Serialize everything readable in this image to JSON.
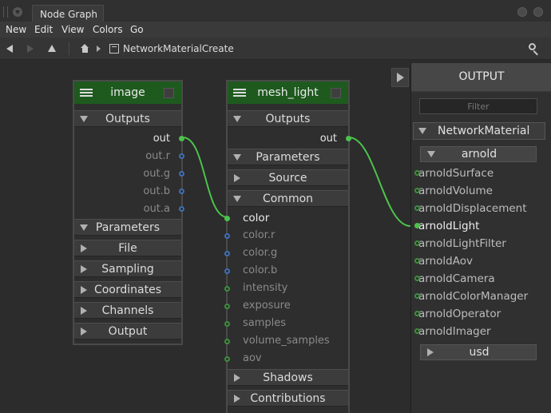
{
  "tab": {
    "title": "Node Graph"
  },
  "menu": [
    "New",
    "Edit",
    "View",
    "Colors",
    "Go"
  ],
  "toolbar": {
    "path": "NetworkMaterialCreate"
  },
  "nodes": {
    "image": {
      "title": "image",
      "outputs_label": "Outputs",
      "ports": [
        "out",
        "out.r",
        "out.g",
        "out.b",
        "out.a"
      ],
      "parameters_label": "Parameters",
      "groups": [
        "File",
        "Sampling",
        "Coordinates",
        "Channels",
        "Output"
      ]
    },
    "mesh_light": {
      "title": "mesh_light",
      "outputs_label": "Outputs",
      "out_port": "out",
      "parameters_label": "Parameters",
      "source_label": "Source",
      "common_label": "Common",
      "params": [
        "color",
        "color.r",
        "color.g",
        "color.b",
        "intensity",
        "exposure",
        "samples",
        "volume_samples",
        "aov"
      ],
      "shadows_label": "Shadows",
      "contributions_label": "Contributions"
    }
  },
  "output_panel": {
    "title": "OUTPUT",
    "filter_placeholder": "Filter",
    "material": "NetworkMaterial",
    "arnold_label": "arnold",
    "items": [
      "arnoldSurface",
      "arnoldVolume",
      "arnoldDisplacement",
      "arnoldLight",
      "arnoldLightFilter",
      "arnoldAov",
      "arnoldCamera",
      "arnoldColorManager",
      "arnoldOperator",
      "arnoldImager"
    ],
    "usd_label": "usd"
  },
  "colors": {
    "node_header": "#1e5a1e",
    "connection": "#4cc24c",
    "connected_port": "#4cc24c",
    "float_port": "#3f6fb8"
  }
}
